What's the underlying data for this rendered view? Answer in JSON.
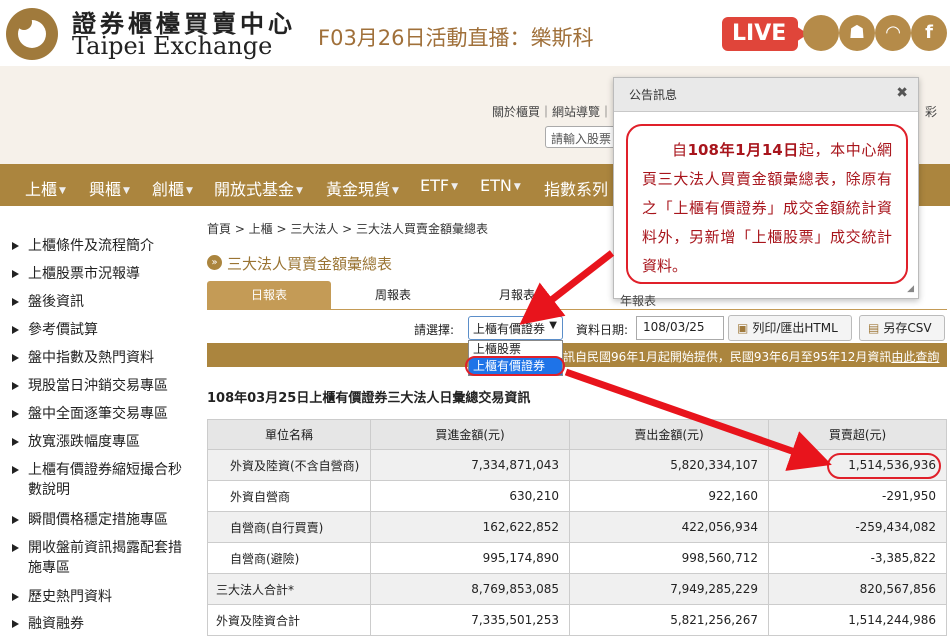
{
  "header": {
    "logo_cn": "證券櫃檯買賣中心",
    "logo_en": "Taipei Exchange",
    "marquee": "F03月26日活動直播：樂斯科",
    "live": "LIVE",
    "social_icons": [
      "apple-icon",
      "android-icon",
      "rss-icon",
      "facebook-icon"
    ],
    "links": "關於櫃買｜網站導覽｜",
    "search_placeholder": "請輸入股票",
    "right_text": "彩"
  },
  "nav": {
    "items": [
      "上櫃",
      "興櫃",
      "創櫃",
      "開放式基金",
      "黃金現貨",
      "ETF",
      "ETN",
      "指數系列"
    ]
  },
  "sidebar": {
    "items": [
      "上櫃條件及流程簡介",
      "上櫃股票市況報導",
      "盤後資訊",
      "參考價試算",
      "盤中指數及熱門資料",
      "現股當日沖銷交易專區",
      "盤中全面逐筆交易專區",
      "放寬漲跌幅度專區",
      "上櫃有價證券縮短撮合秒數說明",
      "瞬間價格穩定措施專區",
      "開收盤前資訊揭露配套措施專區",
      "歷史熱門資料",
      "融資融券"
    ]
  },
  "main": {
    "breadcrumb": "首頁 > 上櫃 > 三大法人 > 三大法人買賣金額彙總表",
    "title": "三大法人買賣金額彙總表",
    "tabs": [
      "日報表",
      "周報表",
      "月報表",
      "年報表"
    ],
    "select_label": "請選擇:",
    "select_value": "上櫃有價證券",
    "select_options": [
      "上櫃股票",
      "上櫃有價證券"
    ],
    "date_label": "資料日期:",
    "date_value": "108/03/25",
    "print_button": "列印/匯出HTML",
    "csv_button": "另存CSV",
    "info_text": "訊自民國96年1月起開始提供，民國93年6月至95年12月資訊",
    "info_link": "由此查詢",
    "subtitle": "108年03月25日上櫃有價證券三大法人日彙總交易資訊",
    "colors": {
      "brand": "#ab853e",
      "annotation_red": "#e0202a"
    }
  },
  "table": {
    "headers": [
      "單位名稱",
      "買進金額(元)",
      "賣出金額(元)",
      "買賣超(元)"
    ],
    "rows": [
      [
        "外資及陸資(不含自營商)",
        "7,334,871,043",
        "5,820,334,107",
        "1,514,536,936"
      ],
      [
        "外資自營商",
        "630,210",
        "922,160",
        "-291,950"
      ],
      [
        "自營商(自行買賣)",
        "162,622,852",
        "422,056,934",
        "-259,434,082"
      ],
      [
        "自營商(避險)",
        "995,174,890",
        "998,560,712",
        "-3,385,822"
      ],
      [
        "三大法人合計*",
        "8,769,853,085",
        "7,949,285,229",
        "820,567,856"
      ],
      [
        "外資及陸資合計",
        "7,335,501,253",
        "5,821,256,267",
        "1,514,244,986"
      ]
    ]
  },
  "popup": {
    "title": "公告訊息",
    "body_pre": "自",
    "body_b1": "108年1月14日",
    "body_post": "起，本中心網頁三大法人買賣金額彙總表，除原有之「上櫃有價證券」成交金額統計資料外，另新增「上櫃股票」成交統計資料。"
  }
}
